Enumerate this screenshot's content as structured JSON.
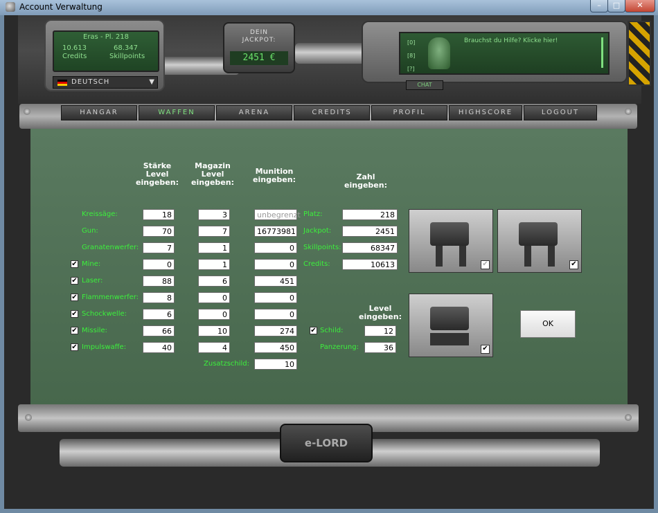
{
  "window": {
    "title": "Account Verwaltung",
    "min": "–",
    "max": "□",
    "close": "✕"
  },
  "player": {
    "name_line": "Eras - Pl. 218",
    "credits_value": "10.613",
    "credits_label": "Credits",
    "skill_value": "68.347",
    "skill_label": "Skillpoints",
    "language": "DEUTSCH",
    "lang_arrow": "▼"
  },
  "jackpot": {
    "label1": "DEIN",
    "label2": "JACKPOT:",
    "value": "2451 €"
  },
  "chat": {
    "lines": [
      "[0]",
      "[8]",
      "[?]"
    ],
    "help": "Brauchst du Hilfe? Klicke hier!",
    "button": "CHAT"
  },
  "tabs": [
    "HANGAR",
    "WAFFEN",
    "ARENA",
    "CREDITS",
    "PROFIL",
    "HIGHSCORE",
    "LOGOUT"
  ],
  "active_tab": "WAFFEN",
  "headers": {
    "staerke": [
      "Stärke",
      "Level",
      "eingeben:"
    ],
    "magazin": [
      "Magazin",
      "Level",
      "eingeben:"
    ],
    "munition": [
      "Munition",
      "eingeben:"
    ],
    "zahl": [
      "Zahl",
      "eingeben:"
    ],
    "level": [
      "Level",
      "eingeben:"
    ]
  },
  "weapons": [
    {
      "name": "Kreissäge:",
      "checkbox": null,
      "staerke": "18",
      "magazin": "3",
      "munition": "unbegrenzt"
    },
    {
      "name": "Gun:",
      "checkbox": null,
      "staerke": "70",
      "magazin": "7",
      "munition": "16773981"
    },
    {
      "name": "Granatenwerfer:",
      "checkbox": null,
      "staerke": "7",
      "magazin": "1",
      "munition": "0"
    },
    {
      "name": "Mine:",
      "checkbox": "✔",
      "staerke": "0",
      "magazin": "1",
      "munition": "0"
    },
    {
      "name": "Laser:",
      "checkbox": "✔",
      "staerke": "88",
      "magazin": "6",
      "munition": "451"
    },
    {
      "name": "Flammenwerfer:",
      "checkbox": "✔",
      "staerke": "8",
      "magazin": "0",
      "munition": "0"
    },
    {
      "name": "Schockwelle:",
      "checkbox": "✔",
      "staerke": "6",
      "magazin": "0",
      "munition": "0"
    },
    {
      "name": "Missile:",
      "checkbox": "✔",
      "staerke": "66",
      "magazin": "10",
      "munition": "274"
    },
    {
      "name": "Impulswaffe:",
      "checkbox": "✔",
      "staerke": "40",
      "magazin": "4",
      "munition": "450"
    }
  ],
  "zusatzschild": {
    "label": "Zusatzschild:",
    "value": "10"
  },
  "stats": [
    {
      "label": "Platz:",
      "value": "218"
    },
    {
      "label": "Jackpot:",
      "value": "2451"
    },
    {
      "label": "Skillpoints:",
      "value": "68347"
    },
    {
      "label": "Credits:",
      "value": "10613"
    }
  ],
  "armor": {
    "schild_check": "✔",
    "schild_label": "Schild:",
    "schild_value": "12",
    "panzerung_label": "Panzerung:",
    "panzerung_value": "36"
  },
  "robots": {
    "check1": "✔",
    "check2": "✔",
    "check3": "✔"
  },
  "ok_button": "OK",
  "footer_logo": "e-LORD"
}
